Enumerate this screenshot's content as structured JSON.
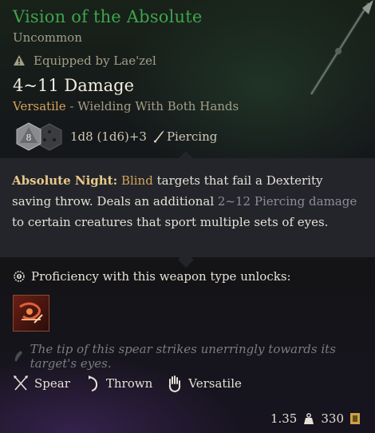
{
  "item": {
    "name": "Vision of the Absolute",
    "rarity": "Uncommon",
    "equipped_text": "Equipped by Lae'zel",
    "damage": "4~11 Damage",
    "versatile_label": "Versatile",
    "versatile_rest": " - Wielding With Both Hands",
    "dice": {
      "d8_label": "8",
      "d6_label": "6",
      "formula": "1d8 (1d6)+3",
      "damage_type": "Piercing"
    }
  },
  "passive": {
    "name": "Absolute Night:",
    "blind": "Blind",
    "text1": " targets that fail a Dexterity saving throw. Deals an additional ",
    "damage_highlight": "2~12 Piercing damage",
    "text2": " to certain creatures that sport multiple sets of eyes."
  },
  "proficiency": {
    "text": "Proficiency with this weapon type unlocks:",
    "action_icon": "weapon-action-icon"
  },
  "flavor": "The tip of this spear strikes unerringly towards its target's eyes.",
  "properties": [
    {
      "label": "Spear",
      "icon": "spear-icon"
    },
    {
      "label": "Thrown",
      "icon": "thrown-icon"
    },
    {
      "label": "Versatile",
      "icon": "versatile-icon"
    }
  ],
  "footer": {
    "weight": "1.35",
    "value": "330"
  },
  "colors": {
    "name": "#3ea44d",
    "muted": "#a59e88",
    "gold": "#d7a45a",
    "passive_bg": "#23252a"
  }
}
